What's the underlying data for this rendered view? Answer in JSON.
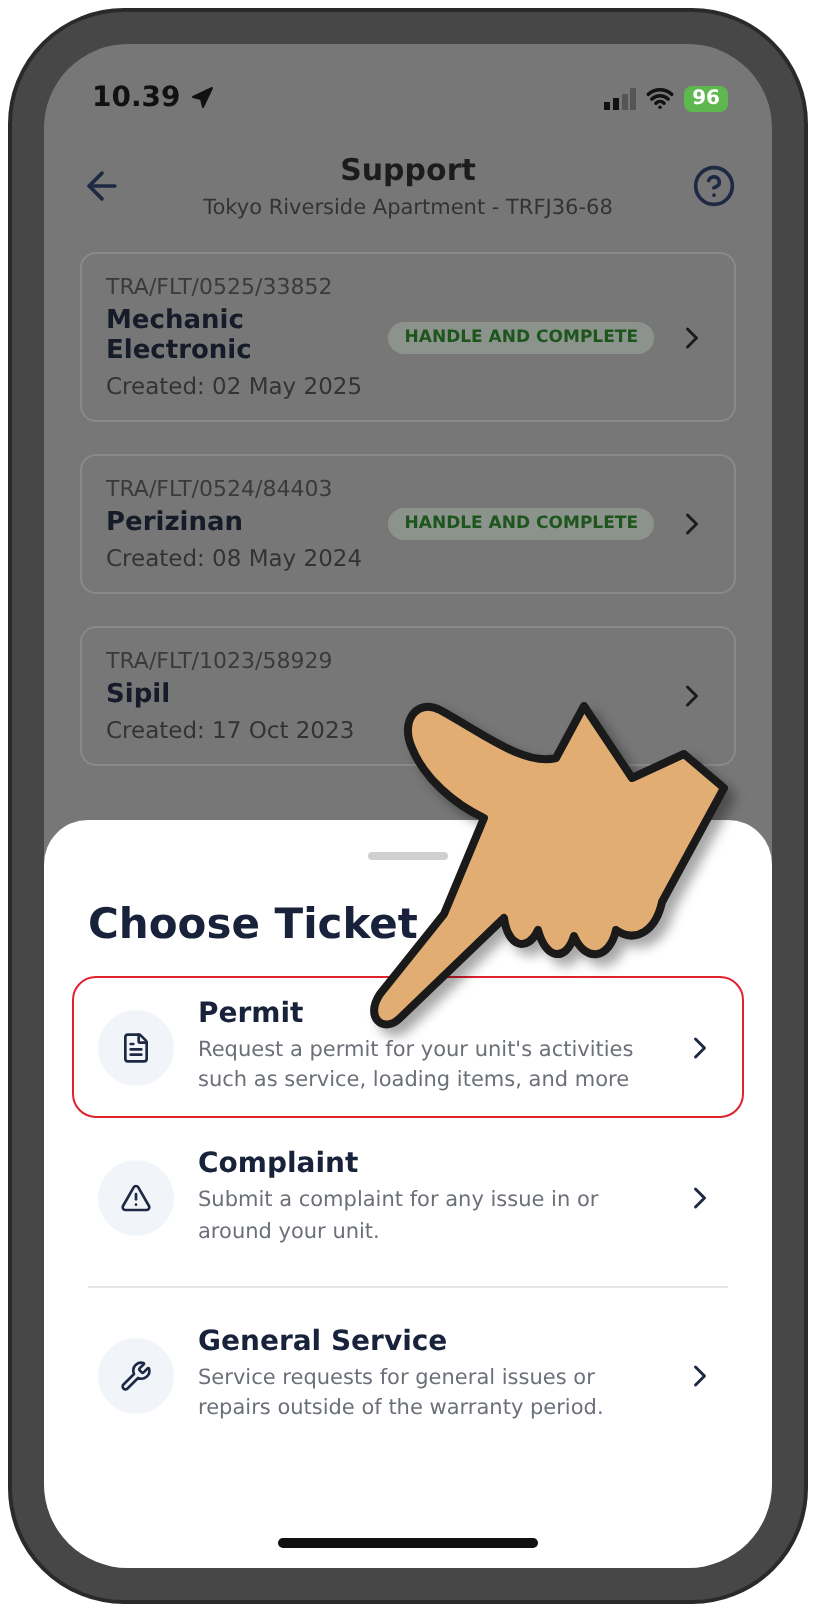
{
  "status_bar": {
    "time": "10.39",
    "battery": "96"
  },
  "header": {
    "title": "Support",
    "subtitle": "Tokyo Riverside Apartment - TRFJ36-68"
  },
  "tickets": [
    {
      "code": "TRA/FLT/0525/33852",
      "title": "Mechanic Electronic",
      "created": "Created: 02 May 2025",
      "status": "HANDLE AND COMPLETE"
    },
    {
      "code": "TRA/FLT/0524/84403",
      "title": "Perizinan",
      "created": "Created: 08 May 2024",
      "status": "HANDLE AND COMPLETE"
    },
    {
      "code": "TRA/FLT/1023/58929",
      "title": "Sipil",
      "created": "Created: 17 Oct 2023"
    }
  ],
  "sheet": {
    "title": "Choose Ticket",
    "options": [
      {
        "kind": "document",
        "title": "Permit",
        "description": "Request a permit for your unit's activities such as service, loading items, and more",
        "selected": true
      },
      {
        "kind": "warning",
        "title": "Complaint",
        "description": "Submit a complaint for any issue in or around your unit.",
        "selected": false
      },
      {
        "kind": "wrench",
        "title": "General Service",
        "description": "Service requests for general issues or repairs outside of the warranty period.",
        "selected": false
      }
    ]
  }
}
